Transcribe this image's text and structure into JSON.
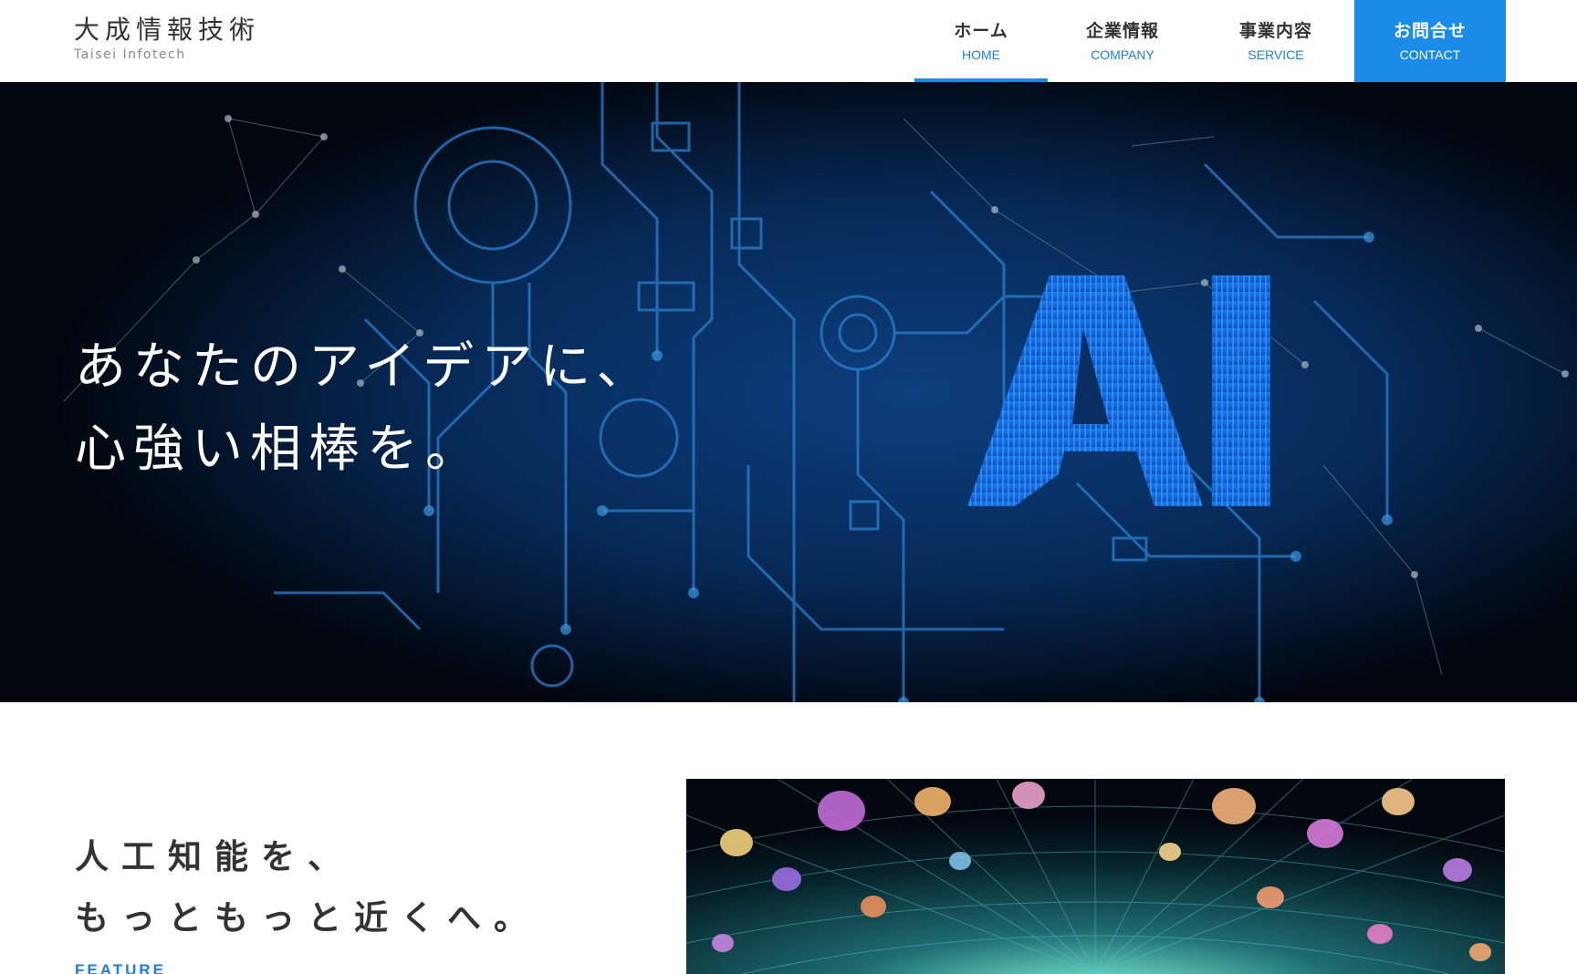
{
  "header": {
    "logo_jp": "大成情報技術",
    "logo_en": "Taisei Infotech"
  },
  "nav": [
    {
      "jp": "ホーム",
      "en": "HOME",
      "active": true
    },
    {
      "jp": "企業情報",
      "en": "COMPANY",
      "active": false
    },
    {
      "jp": "事業内容",
      "en": "SERVICE",
      "active": false
    },
    {
      "jp": "お問合せ",
      "en": "CONTACT",
      "active": false
    }
  ],
  "hero": {
    "line1": "あなたのアイデアに、",
    "line2": "心強い相棒を。",
    "graphic_text": "AI"
  },
  "feature": {
    "heading_line1": "人工知能を、",
    "heading_line2": "もっともっと近くへ。",
    "label": "FEATURE"
  },
  "colors": {
    "accent": "#1a8be8",
    "accent_text": "#1a7fe0",
    "hero_bg": "#02060e",
    "circuit": "#1f6fb8"
  }
}
